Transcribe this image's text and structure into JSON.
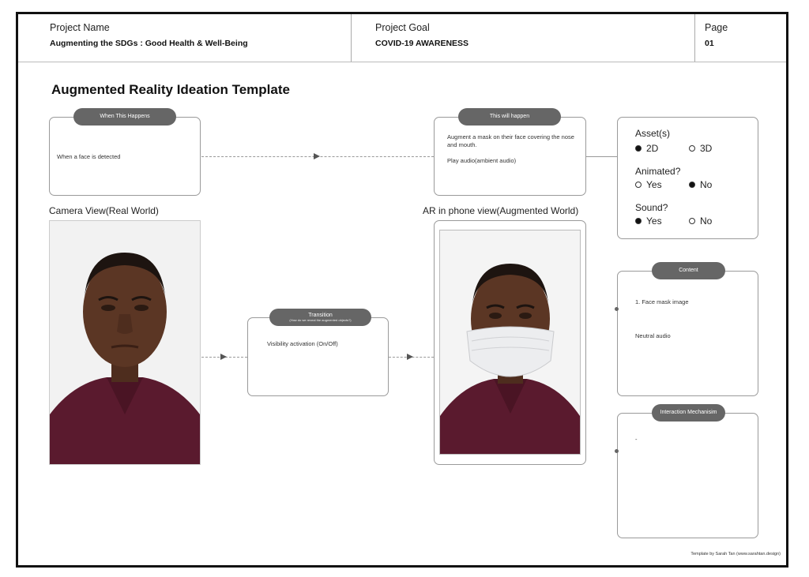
{
  "header": {
    "project_name_label": "Project Name",
    "project_name_value": "Augmenting the SDGs : Good Health & Well-Being",
    "project_goal_label": "Project Goal",
    "project_goal_value": "COVID-19 AWARENESS",
    "page_label": "Page",
    "page_value": "01"
  },
  "template_title": "Augmented Reality Ideation Template",
  "trigger": {
    "pill": "When This Happens",
    "text": "When a face is detected"
  },
  "result": {
    "pill": "This will happen",
    "line1": "Augment a mask on their face covering the nose and mouth.",
    "line2": "Play audio(ambient audio)"
  },
  "assets": {
    "asset_title": "Asset(s)",
    "asset_options": [
      {
        "label": "2D",
        "selected": true
      },
      {
        "label": "3D",
        "selected": false
      }
    ],
    "animated_title": "Animated?",
    "animated_options": [
      {
        "label": "Yes",
        "selected": false
      },
      {
        "label": "No",
        "selected": true
      }
    ],
    "sound_title": "Sound?",
    "sound_options": [
      {
        "label": "Yes",
        "selected": true
      },
      {
        "label": "No",
        "selected": false
      }
    ]
  },
  "camera_view_label": "Camera View(Real World)",
  "ar_view_label": "AR in phone view(Augmented World)",
  "transition": {
    "pill": "Transition",
    "pill_sub": "(How do we reveal the augmented objects?)",
    "text": "Visibility activation (On/Off)"
  },
  "content": {
    "pill": "Content",
    "item1": "1. Face mask image",
    "item2": "Neutral audio"
  },
  "interaction": {
    "pill": "Interaction Mechanisim",
    "text": "-"
  },
  "footer": "Template by Sarah Tan (www.sarahtan.design)",
  "colors": {
    "shirt": "#5a1a2e",
    "skin": "#5b3624",
    "pill": "#666666",
    "mask": "#ecedef"
  }
}
